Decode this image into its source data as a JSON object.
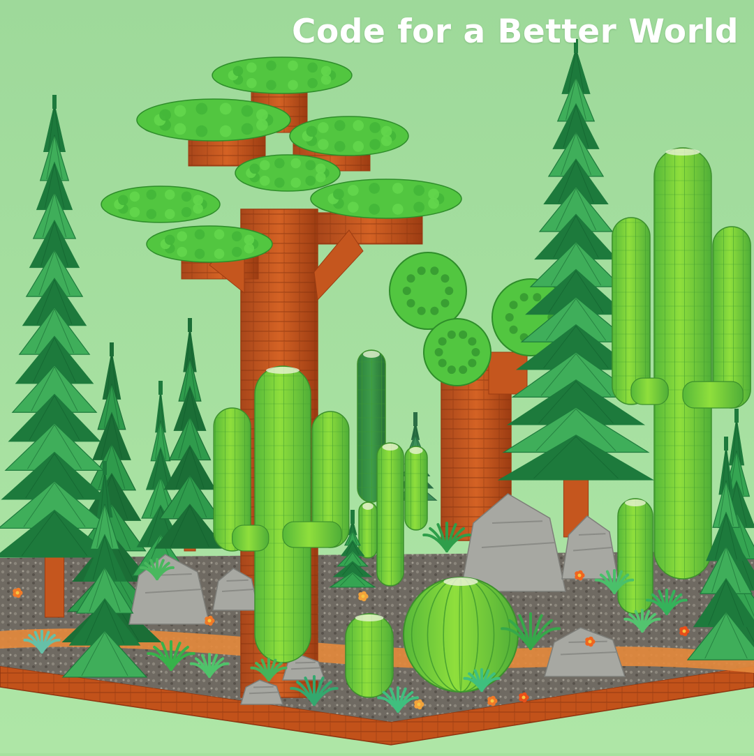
{
  "headline": "Code for a Better World",
  "colors": {
    "background": "#a6e19e",
    "headline": "#ffffff",
    "pine_light": "#3fae5a",
    "pine_dark": "#1d7a3c",
    "cactus_light": "#8fdf3c",
    "cactus_mid": "#5ec43a",
    "cactus_dark": "#2e8a3f",
    "trunk": "#c5561e",
    "trunk_dark": "#9c3c12",
    "canopy": "#52c640",
    "rock": "#a7a8a2",
    "baseplate": "#c2521a",
    "ground": "#6f6a62",
    "path": "#e48a3c"
  },
  "scene_objects": [
    "pine-tree",
    "baobab-tree",
    "round-canopy-tree",
    "saguaro-cactus",
    "barrel-cactus",
    "column-cactus",
    "rock",
    "succulent",
    "flower",
    "baseplate"
  ]
}
